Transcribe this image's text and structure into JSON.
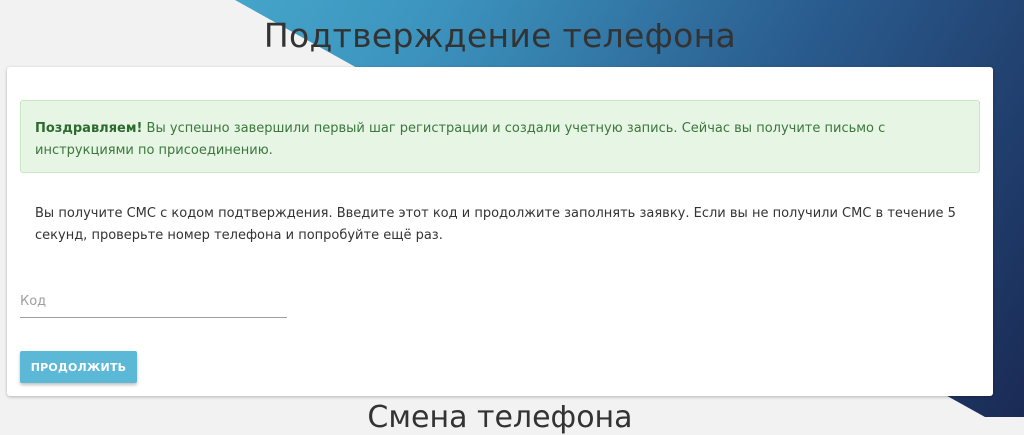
{
  "page": {
    "title": "Подтверждение телефона",
    "next_section_title": "Смена телефона"
  },
  "alert": {
    "strong": "Поздравляем!",
    "text": " Вы успешно завершили первый шаг регистрации и создали учетную запись. Сейчас вы получите письмо с инструкциями по присоединению."
  },
  "info": {
    "text": "Вы получите СМС с кодом подтверждения. Введите этот код и продолжите заполнять заявку. Если вы не получили СМС в течение 5 секунд, проверьте номер телефона и попробуйте ещё раз."
  },
  "code_field": {
    "placeholder": "Код",
    "value": ""
  },
  "actions": {
    "continue_label": "ПРОДОЛЖИТЬ"
  },
  "colors": {
    "accent": "#5bb8d7",
    "success_bg": "#e6f5e4",
    "success_text": "#3c763d"
  }
}
